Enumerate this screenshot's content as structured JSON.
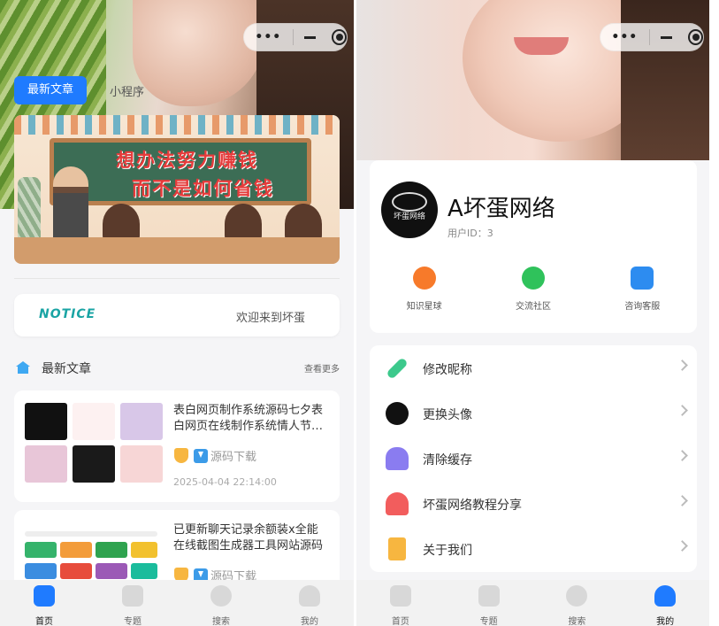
{
  "left": {
    "tabs": {
      "active": "最新文章",
      "other": "小程序"
    },
    "banner": {
      "line1": "想办法努力赚钱",
      "line2": "而不是如何省钱"
    },
    "notice": {
      "logo": "NOTICE",
      "message": "欢迎来到坏蛋"
    },
    "section": {
      "title": "最新文章",
      "more": "查看更多"
    },
    "articles": [
      {
        "title": "表白网页制作系统源码七夕表白网页在线制作系统情人节…",
        "tag": "源码下载",
        "date": "2025-04-04 22:14:00"
      },
      {
        "title": "已更新聊天记录余额装x全能在线截图生成器工具网站源码",
        "tag": "源码下载",
        "date": ""
      }
    ],
    "tabbar": [
      {
        "label": "首页",
        "icon": "home-icon",
        "active": true
      },
      {
        "label": "专题",
        "icon": "topic-icon",
        "active": false
      },
      {
        "label": "搜索",
        "icon": "search-icon",
        "active": false
      },
      {
        "label": "我的",
        "icon": "user-icon",
        "active": false
      }
    ]
  },
  "right": {
    "profile": {
      "name": "A坏蛋网络",
      "user_id": "用户ID：3",
      "avatar_text": "坏蛋网络"
    },
    "shortcuts": [
      {
        "label": "知识星球",
        "icon": "planet-icon",
        "color": "#f77a2a"
      },
      {
        "label": "交流社区",
        "icon": "chat-icon",
        "color": "#2fc25b"
      },
      {
        "label": "咨询客服",
        "icon": "service-icon",
        "color": "#2d8cf0"
      }
    ],
    "menu": [
      {
        "label": "修改昵称",
        "icon": "edit-icon",
        "color": "#3cc98c"
      },
      {
        "label": "更换头像",
        "icon": "avatar-icon",
        "color": "#111111"
      },
      {
        "label": "清除缓存",
        "icon": "broom-icon",
        "color": "#8a7cf0"
      },
      {
        "label": "坏蛋网络教程分享",
        "icon": "bell-icon",
        "color": "#f25d5d"
      },
      {
        "label": "关于我们",
        "icon": "book-icon",
        "color": "#f7b640"
      }
    ],
    "tabbar": [
      {
        "label": "首页",
        "icon": "home-icon",
        "active": false
      },
      {
        "label": "专题",
        "icon": "topic-icon",
        "active": false
      },
      {
        "label": "搜索",
        "icon": "search-icon",
        "active": false
      },
      {
        "label": "我的",
        "icon": "user-icon",
        "active": true
      }
    ]
  },
  "capsule": {
    "dots": "•••"
  }
}
